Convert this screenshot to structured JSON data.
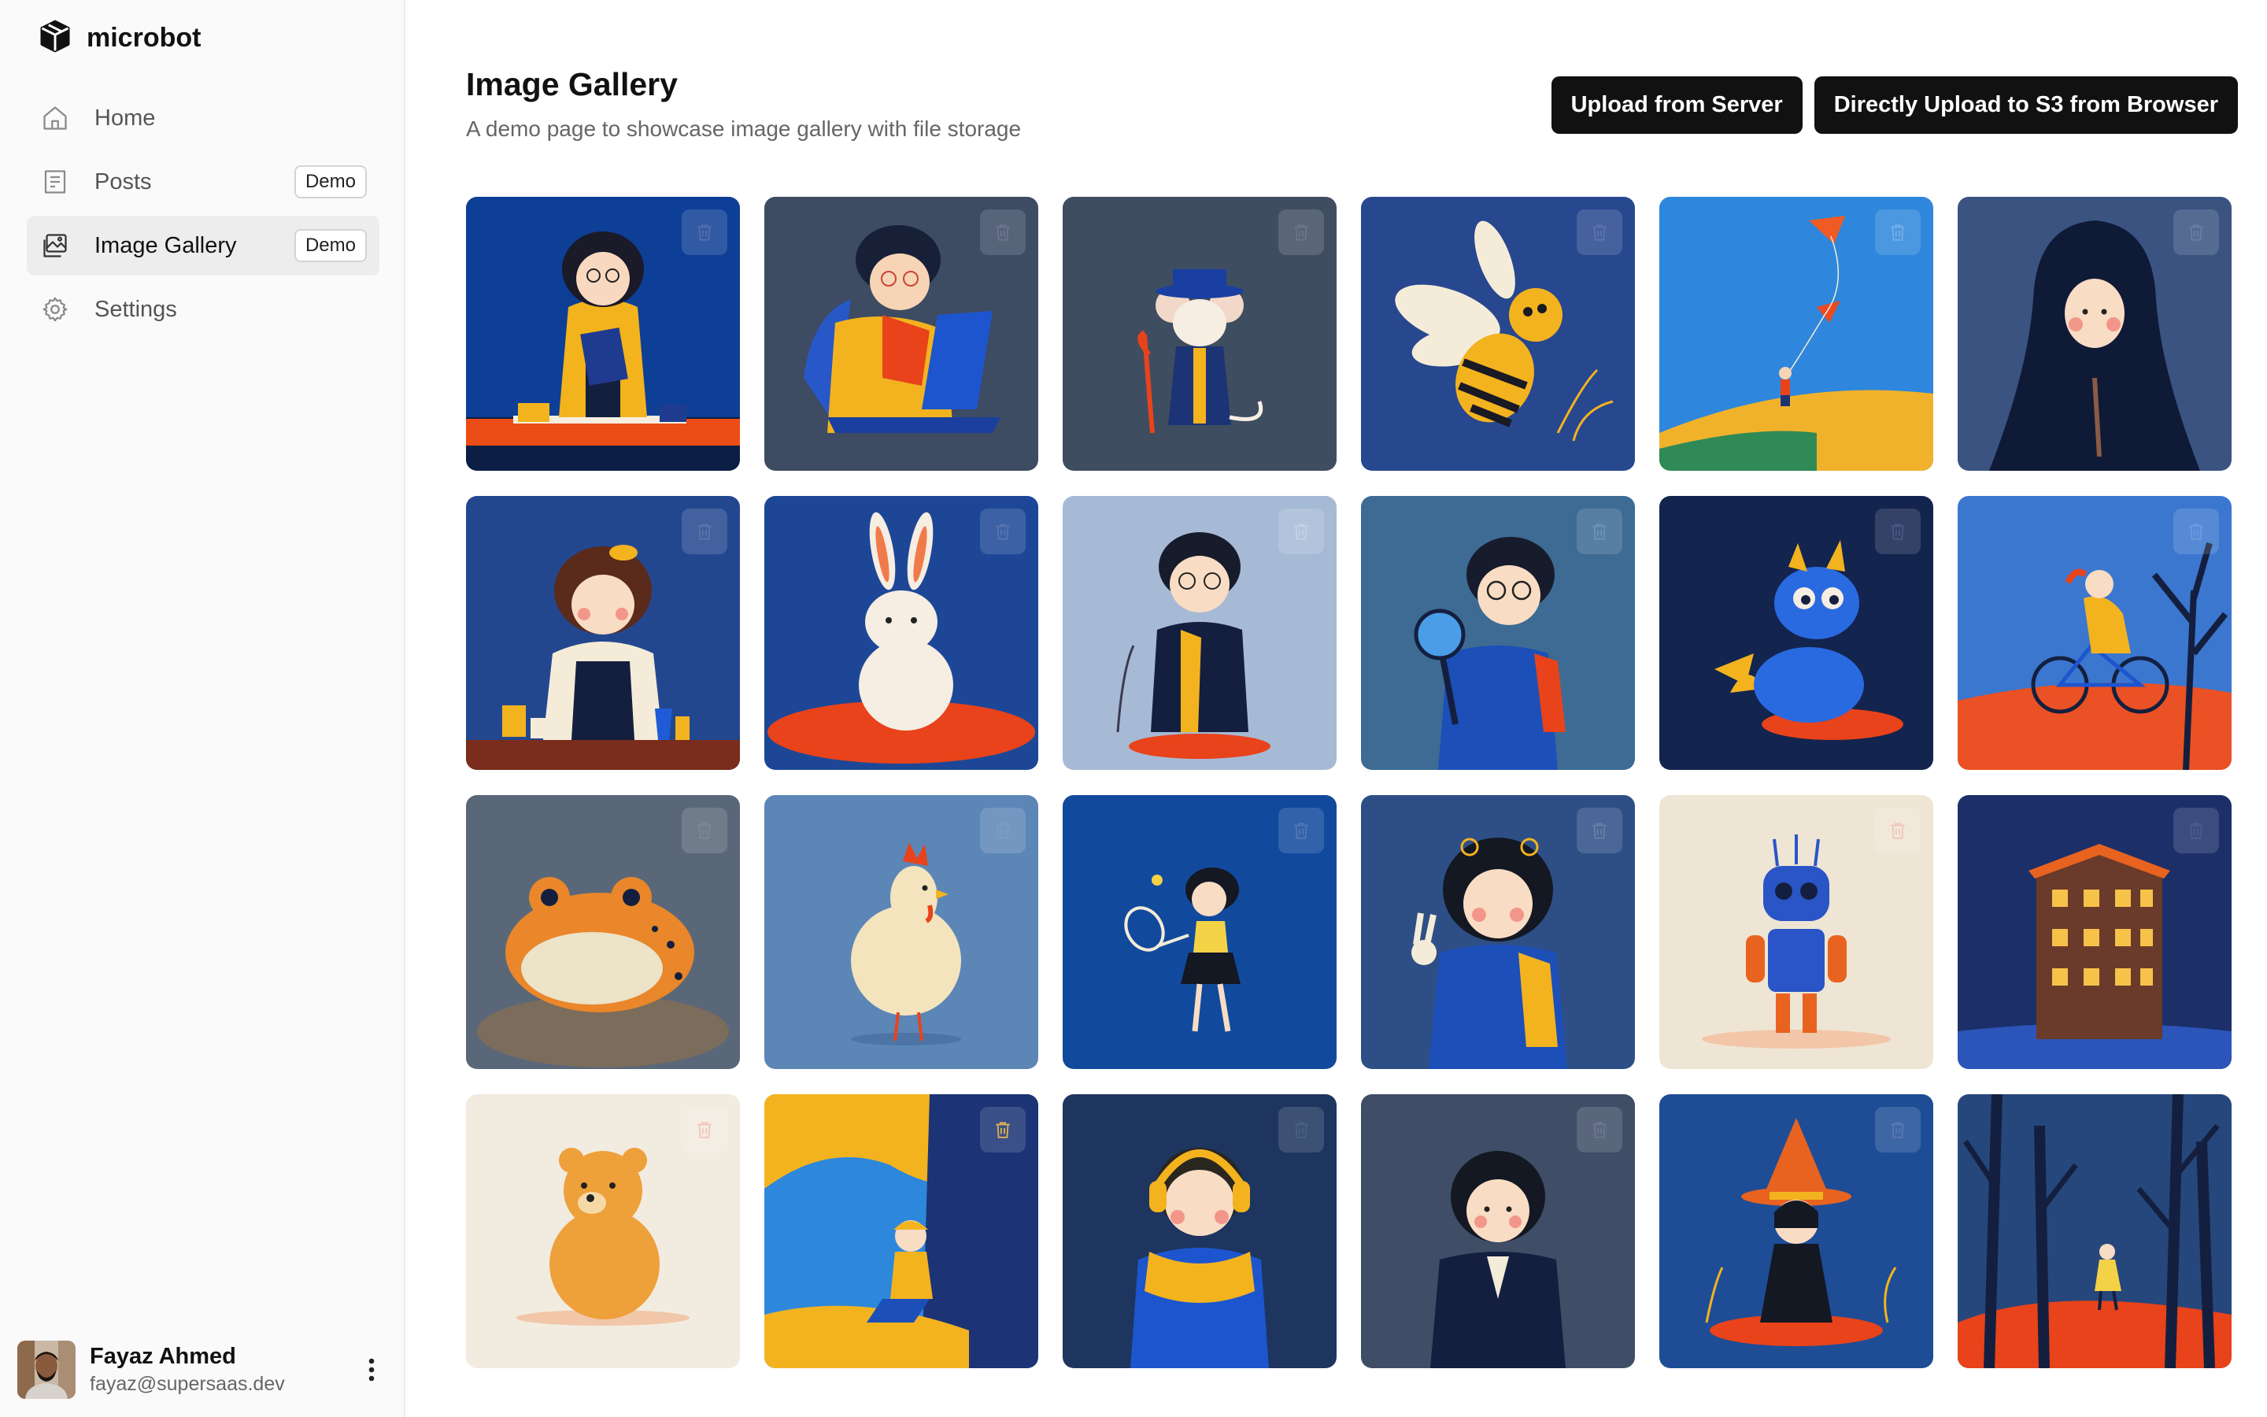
{
  "app": {
    "name": "microbot"
  },
  "sidebar": {
    "items": [
      {
        "label": "Home",
        "icon": "home-icon",
        "badge": ""
      },
      {
        "label": "Posts",
        "icon": "posts-icon",
        "badge": "Demo"
      },
      {
        "label": "Image Gallery",
        "icon": "image-icon",
        "badge": "Demo",
        "active": true
      },
      {
        "label": "Settings",
        "icon": "gear-icon",
        "badge": ""
      }
    ]
  },
  "user": {
    "name": "Fayaz Ahmed",
    "email": "fayaz@supersaas.dev"
  },
  "page": {
    "title": "Image Gallery",
    "subtitle": "A demo page to showcase image gallery with file storage"
  },
  "actions": {
    "upload_server": "Upload from Server",
    "upload_browser": "Directly Upload to S3 from Browser"
  },
  "colors": {
    "accent": "#111111",
    "sidebar_bg": "#fafafa",
    "active_bg": "#ededed"
  },
  "gallery": [
    {
      "subject": "girl-with-folder",
      "bg": "#0e3f96"
    },
    {
      "subject": "boy-with-laptop",
      "bg": "#3d4b63"
    },
    {
      "subject": "mouse-wizard",
      "bg": "#3f4d60"
    },
    {
      "subject": "bee",
      "bg": "#27478f"
    },
    {
      "subject": "kite",
      "bg": "#2e87dc"
    },
    {
      "subject": "girl-in-hijab",
      "bg": "#3a5381"
    },
    {
      "subject": "girl-barista",
      "bg": "#23478f"
    },
    {
      "subject": "rabbit",
      "bg": "#1d4796"
    },
    {
      "subject": "boy-with-scarf",
      "bg": "#a6bad6"
    },
    {
      "subject": "boy-with-magnifier",
      "bg": "#3d6b93"
    },
    {
      "subject": "dragon",
      "bg": "#13244f"
    },
    {
      "subject": "girl-on-bicycle",
      "bg": "#3b77cf"
    },
    {
      "subject": "frog",
      "bg": "#5a6779"
    },
    {
      "subject": "chicken",
      "bg": "#5c86b6"
    },
    {
      "subject": "girl-with-racket",
      "bg": "#114a9c"
    },
    {
      "subject": "girl-peace-sign",
      "bg": "#2e4f86"
    },
    {
      "subject": "robot",
      "bg": "#efe5d5"
    },
    {
      "subject": "house-at-night",
      "bg": "#1d2f69"
    },
    {
      "subject": "bear",
      "bg": "#f2ebe0"
    },
    {
      "subject": "boy-under-tree",
      "bg": "#2d88dc"
    },
    {
      "subject": "boy-with-headphones",
      "bg": "#1e355f"
    },
    {
      "subject": "girl-in-blazer",
      "bg": "#3f4d67"
    },
    {
      "subject": "little-witch",
      "bg": "#1e4d96"
    },
    {
      "subject": "forest-walk",
      "bg": "#26477b"
    }
  ]
}
